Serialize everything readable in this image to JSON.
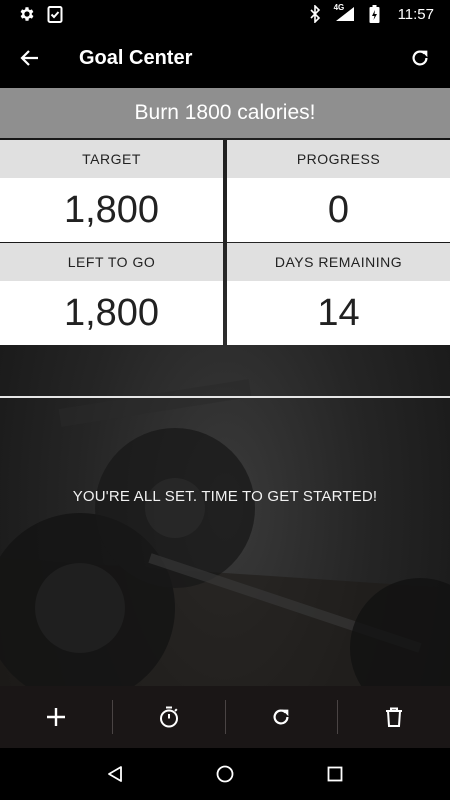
{
  "status_bar": {
    "time": "11:57",
    "network": "4G",
    "icons": [
      "settings-icon",
      "clipboard-check-icon",
      "bluetooth-icon",
      "signal-icon",
      "battery-icon"
    ]
  },
  "app_bar": {
    "title": "Goal Center",
    "back_icon": "arrow-left-icon",
    "refresh_icon": "refresh-icon"
  },
  "goal": {
    "banner": "Burn 1800 calories!"
  },
  "stats": [
    {
      "label": "TARGET",
      "value": "1,800"
    },
    {
      "label": "PROGRESS",
      "value": "0"
    },
    {
      "label": "LEFT TO GO",
      "value": "1,800"
    },
    {
      "label": "DAYS REMAINING",
      "value": "14"
    }
  ],
  "message": "YOU'RE ALL SET. TIME TO GET STARTED!",
  "actions": [
    "add-icon",
    "timer-icon",
    "refresh-icon",
    "trash-icon"
  ],
  "nav": [
    "back-triangle-icon",
    "home-circle-icon",
    "recents-square-icon"
  ],
  "colors": {
    "banner_bg": "#8f8f8f",
    "label_bg": "#e0e0e0",
    "value_bg": "#ffffff",
    "action_bar_bg": "#1a1616"
  }
}
